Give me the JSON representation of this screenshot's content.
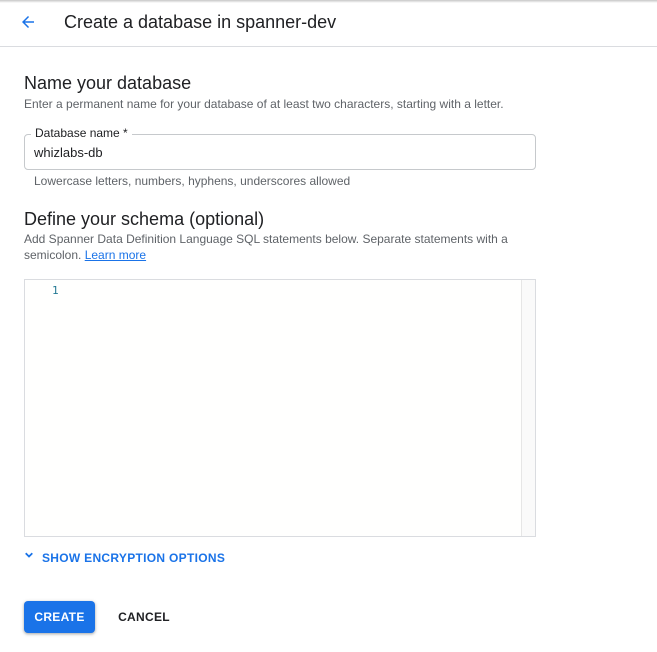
{
  "header": {
    "title": "Create a database in spanner-dev",
    "back_icon": "arrow-back-icon"
  },
  "name_section": {
    "title": "Name your database",
    "description": "Enter a permanent name for your database of at least two characters, starting with a letter.",
    "field_label": "Database name *",
    "field_value": "whizlabs-db",
    "hint": "Lowercase letters, numbers, hyphens, underscores allowed"
  },
  "schema_section": {
    "title": "Define your schema (optional)",
    "description": "Add Spanner Data Definition Language SQL statements below. Separate statements with a semicolon.",
    "learn_more": "Learn more",
    "editor": {
      "line_numbers": [
        "1"
      ],
      "content": ""
    }
  },
  "encryption": {
    "toggle_label": "SHOW ENCRYPTION OPTIONS",
    "icon": "chevron-down-icon"
  },
  "actions": {
    "create_label": "CREATE",
    "cancel_label": "CANCEL"
  },
  "colors": {
    "primary": "#1a73e8",
    "text": "#202124",
    "secondary_text": "#5f6368",
    "border": "#dadce0",
    "line_number": "#237893"
  }
}
